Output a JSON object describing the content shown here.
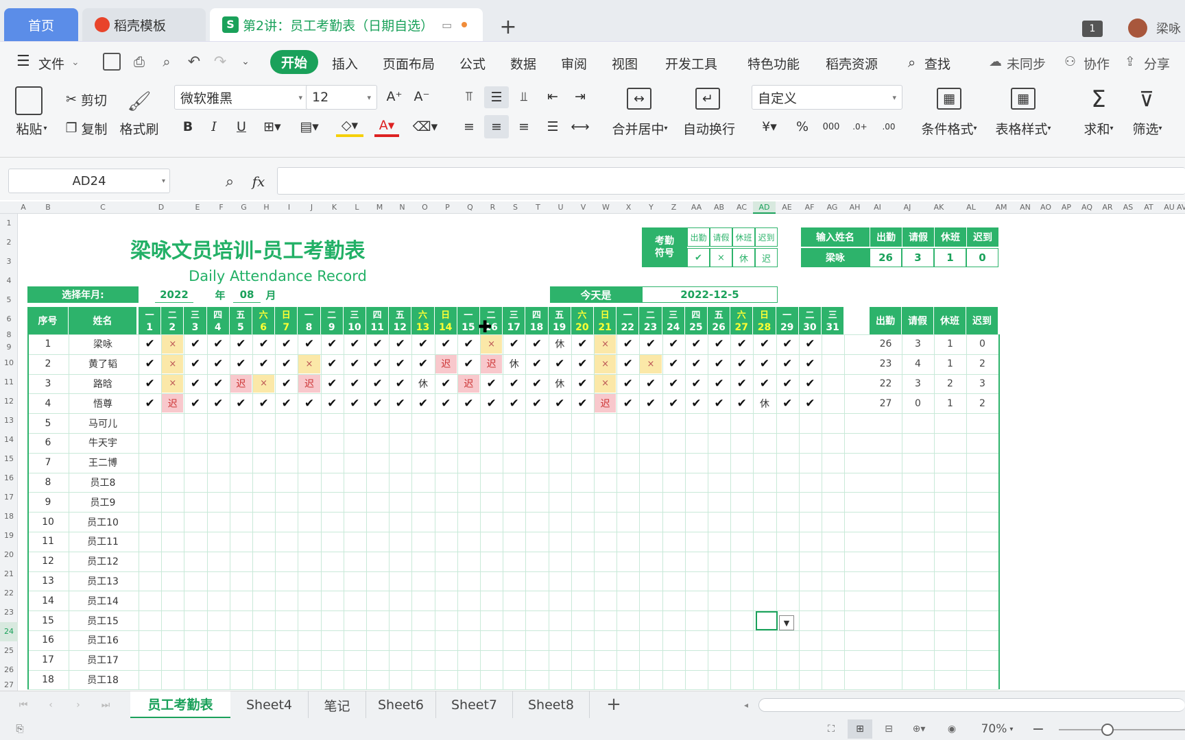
{
  "tabs": {
    "home": "首页",
    "template": "稻壳模板",
    "doc": "第2讲：员工考勤表（日期自选）",
    "count": "1",
    "user": "梁咏"
  },
  "menu": {
    "items": [
      "文件",
      "开始",
      "插入",
      "页面布局",
      "公式",
      "数据",
      "审阅",
      "视图",
      "开发工具",
      "特色功能",
      "稻壳资源",
      "查找"
    ],
    "sync": "未同步",
    "collab": "协作",
    "share": "分享"
  },
  "ribbon": {
    "paste": "粘贴",
    "cut": "剪切",
    "copy": "复制",
    "format_painter": "格式刷",
    "font": "微软雅黑",
    "size": "12",
    "merge": "合并居中",
    "wrap": "自动换行",
    "number_format": "自定义",
    "cond_format": "条件格式",
    "table_style": "表格样式",
    "sum": "求和",
    "filter": "筛选",
    "bold": "B",
    "italic": "I",
    "underline": "U"
  },
  "formula": {
    "cell_ref": "AD24",
    "fx": "fx",
    "value": ""
  },
  "col_headers": [
    "A",
    "B",
    "C",
    "D",
    "E",
    "F",
    "G",
    "H",
    "I",
    "J",
    "K",
    "L",
    "M",
    "N",
    "O",
    "P",
    "Q",
    "R",
    "S",
    "T",
    "U",
    "V",
    "W",
    "X",
    "Y",
    "Z",
    "AA",
    "AB",
    "AC",
    "AD",
    "AE",
    "AF",
    "AG",
    "AH",
    "AI",
    "AJ",
    "AK",
    "AL",
    "AM",
    "AN",
    "AO",
    "AP",
    "AQ",
    "AR",
    "AS",
    "AT",
    "AU",
    "AV"
  ],
  "row_headers": [
    "1",
    "2",
    "3",
    "4",
    "5",
    "6",
    "8",
    "9",
    "10",
    "11",
    "12",
    "13",
    "14",
    "15",
    "16",
    "17",
    "18",
    "19",
    "20",
    "21",
    "22",
    "23",
    "24",
    "25",
    "26",
    "27"
  ],
  "sheet": {
    "title": "梁咏文员培训-员工考勤表",
    "subtitle": "Daily Attendance Record",
    "select_label": "选择年月:",
    "year": "2022",
    "year_unit": "年",
    "month": "08",
    "month_unit": "月",
    "today_label": "今天是",
    "today_value": "2022-12-5",
    "legend": {
      "title": "考勤\n符号",
      "items": [
        [
          "出勤",
          "✔"
        ],
        [
          "请假",
          "×"
        ],
        [
          "休班",
          "休"
        ],
        [
          "迟到",
          "迟"
        ]
      ]
    },
    "lookup": {
      "label": "输入姓名",
      "name": "梁咏",
      "headers": [
        "出勤",
        "请假",
        "休班",
        "迟到"
      ],
      "values": [
        "26",
        "3",
        "1",
        "0"
      ]
    },
    "headers": {
      "seq": "序号",
      "name": "姓名",
      "summary": [
        "出勤",
        "请假",
        "休班",
        "迟到"
      ]
    },
    "weekdays": [
      "一",
      "二",
      "三",
      "四",
      "五",
      "六",
      "日",
      "一",
      "二",
      "三",
      "四",
      "五",
      "六",
      "日",
      "一",
      "二",
      "三",
      "四",
      "五",
      "六",
      "日",
      "一",
      "二",
      "三",
      "四",
      "五",
      "六",
      "日",
      "一",
      "二",
      "三"
    ],
    "days": [
      "1",
      "2",
      "3",
      "4",
      "5",
      "6",
      "7",
      "8",
      "9",
      "10",
      "11",
      "12",
      "13",
      "14",
      "15",
      "16",
      "17",
      "18",
      "19",
      "20",
      "21",
      "22",
      "23",
      "24",
      "25",
      "26",
      "27",
      "28",
      "29",
      "30",
      "31"
    ],
    "employees": [
      {
        "seq": "1",
        "name": "梁咏",
        "marks": [
          "✔",
          "×",
          "✔",
          "✔",
          "✔",
          "✔",
          "✔",
          "✔",
          "✔",
          "✔",
          "✔",
          "✔",
          "✔",
          "✔",
          "✔",
          "×",
          "✔",
          "✔",
          "休",
          "✔",
          "×",
          "✔",
          "✔",
          "✔",
          "✔",
          "✔",
          "✔",
          "✔",
          "✔",
          "✔",
          ""
        ],
        "summary": [
          "26",
          "3",
          "1",
          "0"
        ]
      },
      {
        "seq": "2",
        "name": "黄了韬",
        "marks": [
          "✔",
          "×",
          "✔",
          "✔",
          "✔",
          "✔",
          "✔",
          "×",
          "✔",
          "✔",
          "✔",
          "✔",
          "✔",
          "迟",
          "✔",
          "迟",
          "休",
          "✔",
          "✔",
          "✔",
          "×",
          "✔",
          "×",
          "✔",
          "✔",
          "✔",
          "✔",
          "✔",
          "✔",
          "✔",
          ""
        ],
        "summary": [
          "23",
          "4",
          "1",
          "2"
        ]
      },
      {
        "seq": "3",
        "name": "路晗",
        "marks": [
          "✔",
          "×",
          "✔",
          "✔",
          "迟",
          "×",
          "✔",
          "迟",
          "✔",
          "✔",
          "✔",
          "✔",
          "休",
          "✔",
          "迟",
          "✔",
          "✔",
          "✔",
          "休",
          "✔",
          "×",
          "✔",
          "✔",
          "✔",
          "✔",
          "✔",
          "✔",
          "✔",
          "✔",
          "✔",
          ""
        ],
        "summary": [
          "22",
          "3",
          "2",
          "3"
        ]
      },
      {
        "seq": "4",
        "name": "悟尊",
        "marks": [
          "✔",
          "迟",
          "✔",
          "✔",
          "✔",
          "✔",
          "✔",
          "✔",
          "✔",
          "✔",
          "✔",
          "✔",
          "✔",
          "✔",
          "✔",
          "✔",
          "✔",
          "✔",
          "✔",
          "✔",
          "迟",
          "✔",
          "✔",
          "✔",
          "✔",
          "✔",
          "✔",
          "休",
          "✔",
          "✔",
          ""
        ],
        "summary": [
          "27",
          "0",
          "1",
          "2"
        ]
      },
      {
        "seq": "5",
        "name": "马可儿",
        "marks": [],
        "summary": []
      },
      {
        "seq": "6",
        "name": "牛天宇",
        "marks": [],
        "summary": []
      },
      {
        "seq": "7",
        "name": "王二博",
        "marks": [],
        "summary": []
      },
      {
        "seq": "8",
        "name": "员工8",
        "marks": [],
        "summary": []
      },
      {
        "seq": "9",
        "name": "员工9",
        "marks": [],
        "summary": []
      },
      {
        "seq": "10",
        "name": "员工10",
        "marks": [],
        "summary": []
      },
      {
        "seq": "11",
        "name": "员工11",
        "marks": [],
        "summary": []
      },
      {
        "seq": "12",
        "name": "员工12",
        "marks": [],
        "summary": []
      },
      {
        "seq": "13",
        "name": "员工13",
        "marks": [],
        "summary": []
      },
      {
        "seq": "14",
        "name": "员工14",
        "marks": [],
        "summary": []
      },
      {
        "seq": "15",
        "name": "员工15",
        "marks": [],
        "summary": []
      },
      {
        "seq": "16",
        "name": "员工16",
        "marks": [],
        "summary": []
      },
      {
        "seq": "17",
        "name": "员工17",
        "marks": [],
        "summary": []
      },
      {
        "seq": "18",
        "name": "员工18",
        "marks": [],
        "summary": []
      }
    ]
  },
  "sheet_tabs": [
    "员工考勤表",
    "Sheet4",
    "笔记",
    "Sheet6",
    "Sheet7",
    "Sheet8"
  ],
  "status": {
    "zoom": "70%"
  },
  "colors": {
    "green": "#2db36b",
    "yellow": "#ffff33",
    "late_bg": "#f8c8cc",
    "leave_bg": "#fbe8a8",
    "accent": "#1aa15a"
  }
}
